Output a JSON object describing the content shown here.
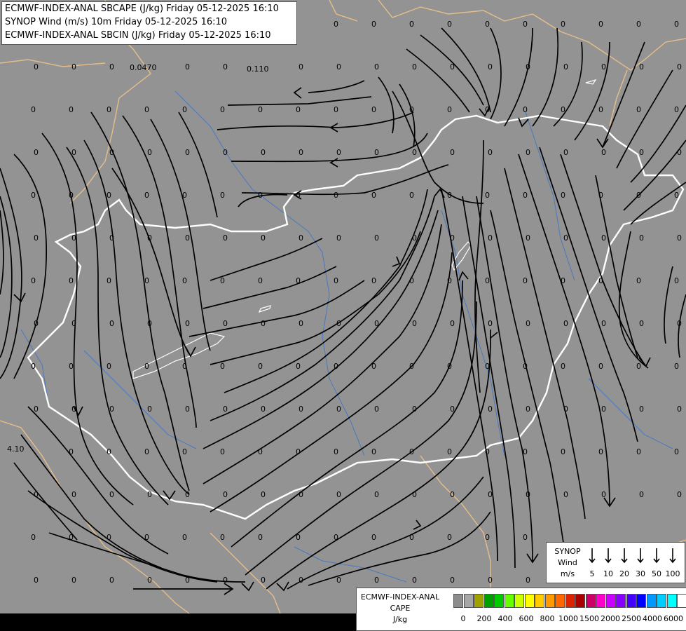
{
  "title_lines": [
    "ECMWF-INDEX-ANAL SBCAPE (J/kg) Friday 05-12-2025 16:10",
    "SYNOP Wind (m/s) 10m Friday 05-12-2025 16:10",
    "ECMWF-INDEX-ANAL SBCIN (J/kg) Friday 05-12-2025 16:10"
  ],
  "synop_legend": {
    "title": "SYNOP",
    "line2": "Wind",
    "unit": "m/s",
    "values": [
      "5",
      "10",
      "20",
      "30",
      "50",
      "100"
    ]
  },
  "cape_legend": {
    "title": "ECMWF-INDEX-ANAL",
    "line2": "CAPE",
    "unit": "J/kg",
    "ticks": [
      "0",
      "200",
      "400",
      "600",
      "800",
      "1000",
      "1500",
      "2000",
      "2500",
      "4000",
      "6000"
    ],
    "colors": [
      "#8c8c8c",
      "#a6a6a6",
      "#a0a000",
      "#00a000",
      "#00cc00",
      "#66ff00",
      "#ccff00",
      "#ffff00",
      "#ffcc00",
      "#ff9900",
      "#ff6600",
      "#dd2200",
      "#aa0000",
      "#cc0066",
      "#ff00cc",
      "#cc00ff",
      "#8800ff",
      "#4400ff",
      "#0000ff",
      "#0099ff",
      "#00ccff",
      "#00ffff",
      "#ffffff"
    ]
  },
  "colors": {
    "background": "#939393",
    "streamline": "#000000",
    "border_country": "#ffffff",
    "border_region": "#e6be8a",
    "river": "#4a78c0",
    "footer": "#000000"
  },
  "grid_labels": [
    {
      "text": "0.0470"
    },
    {
      "text": "0.110"
    },
    {
      "text": "4.10"
    }
  ],
  "zero_label": "0"
}
